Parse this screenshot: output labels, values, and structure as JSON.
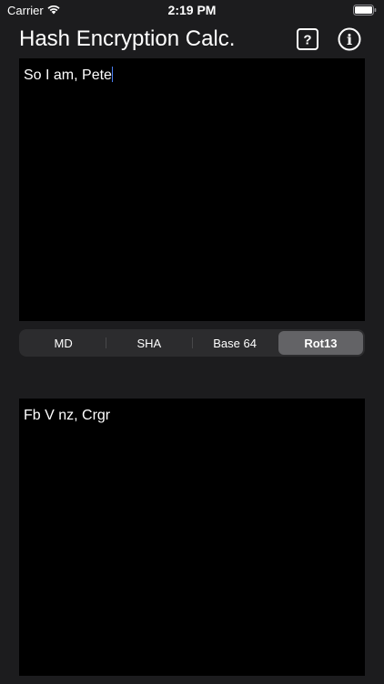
{
  "status_bar": {
    "carrier": "Carrier",
    "time": "2:19 PM",
    "icons": [
      "wifi-icon",
      "battery-icon"
    ]
  },
  "nav": {
    "title": "Hash Encryption Calc.",
    "help_icon_glyph": "?",
    "info_icon_glyph": "i"
  },
  "input": {
    "value": "So I am, Pete"
  },
  "segments": [
    {
      "label": "MD",
      "selected": false
    },
    {
      "label": "SHA",
      "selected": false
    },
    {
      "label": "Base 64",
      "selected": false
    },
    {
      "label": "Rot13",
      "selected": true
    }
  ],
  "output": {
    "value": "Fb V nz, Crgr"
  },
  "colors": {
    "background": "#1c1c1e",
    "text_area": "#000000",
    "segment_track": "#2c2c2e",
    "segment_selected": "#636366",
    "caret": "#4a7df0"
  }
}
